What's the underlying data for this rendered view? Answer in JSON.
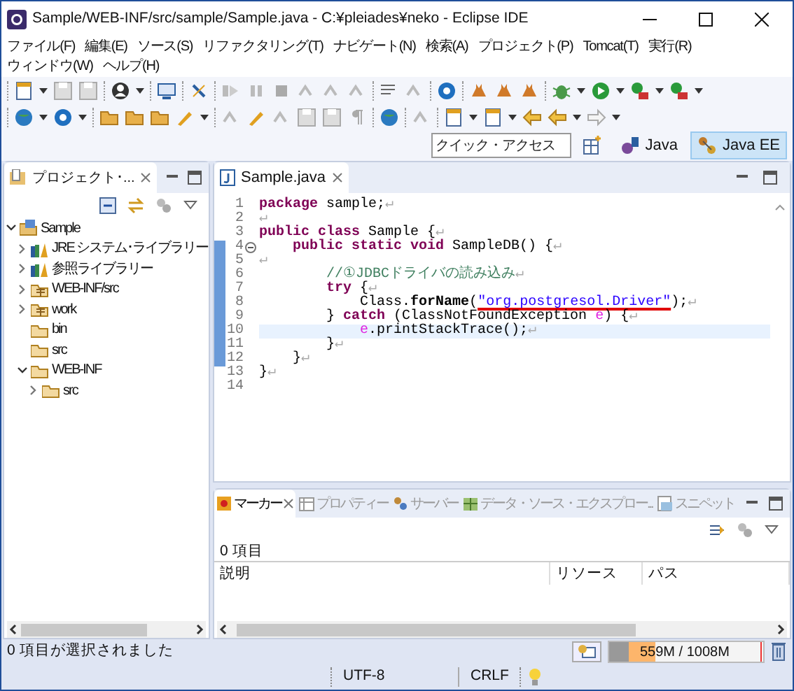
{
  "window": {
    "title": "Sample/WEB-INF/src/sample/Sample.java - C:¥pleiades¥neko - Eclipse IDE"
  },
  "menu": [
    "ファイル(F)",
    "編集(E)",
    "ソース(S)",
    "リファクタリング(T)",
    "ナビゲート(N)",
    "検索(A)",
    "プロジェクト(P)",
    "Tomcat(T)",
    "実行(R)",
    "ウィンドウ(W)",
    "ヘルプ(H)"
  ],
  "quick_access": {
    "placeholder": "クイック・アクセス"
  },
  "perspectives": [
    {
      "label": "Java",
      "selected": false
    },
    {
      "label": "Java EE",
      "selected": true
    }
  ],
  "explorer": {
    "tab": "プロジェクト･...",
    "tree": [
      {
        "label": "Sample",
        "kind": "project",
        "expanded": true,
        "children": [
          {
            "label": "JRE システム･ライブラリー",
            "kind": "library",
            "expanded": false
          },
          {
            "label": "参照ライブラリー",
            "kind": "library",
            "expanded": false
          },
          {
            "label": "WEB-INF/src",
            "kind": "package-folder",
            "expanded": false
          },
          {
            "label": "work",
            "kind": "package-folder",
            "expanded": false
          },
          {
            "label": "bin",
            "kind": "folder"
          },
          {
            "label": "src",
            "kind": "folder"
          },
          {
            "label": "WEB-INF",
            "kind": "folder",
            "expanded": true,
            "children": [
              {
                "label": "src",
                "kind": "folder",
                "expanded": false
              }
            ]
          }
        ]
      }
    ]
  },
  "editor": {
    "tab": "Sample.java",
    "lines": [
      {
        "number": "1",
        "current": false,
        "changed": false,
        "segments": [
          {
            "kind": "keyword",
            "text": "package"
          },
          {
            "kind": "plain",
            "text": " sample;"
          },
          {
            "kind": "mark",
            "text": "↵"
          }
        ]
      },
      {
        "number": "2",
        "current": false,
        "changed": false,
        "segments": [
          {
            "kind": "mark",
            "text": "↵"
          }
        ]
      },
      {
        "number": "3",
        "current": false,
        "changed": false,
        "segments": [
          {
            "kind": "keyword",
            "text": "public class"
          },
          {
            "kind": "plain",
            "text": " Sample {"
          },
          {
            "kind": "mark",
            "text": "↵"
          }
        ]
      },
      {
        "number": "4",
        "current": false,
        "changed": true,
        "fold": true,
        "segments": [
          {
            "kind": "keyword",
            "text": "    public static void"
          },
          {
            "kind": "plain",
            "text": " SampleDB() {"
          },
          {
            "kind": "mark",
            "text": "↵"
          }
        ]
      },
      {
        "number": "5",
        "current": false,
        "changed": true,
        "segments": [
          {
            "kind": "mark",
            "text": "↵"
          }
        ]
      },
      {
        "number": "6",
        "current": false,
        "changed": true,
        "segments": [
          {
            "kind": "comment",
            "text": "        //①JDBCドライバの読み込み"
          },
          {
            "kind": "mark",
            "text": "↵"
          }
        ]
      },
      {
        "number": "7",
        "current": false,
        "changed": true,
        "segments": [
          {
            "kind": "keyword",
            "text": "        try"
          },
          {
            "kind": "plain",
            "text": " {"
          },
          {
            "kind": "mark",
            "text": "↵"
          }
        ]
      },
      {
        "number": "8",
        "current": false,
        "changed": true,
        "segments": [
          {
            "kind": "plain",
            "text": "            Class."
          },
          {
            "kind": "method",
            "text": "forName"
          },
          {
            "kind": "plain",
            "text": "("
          },
          {
            "kind": "string",
            "text": "\"org.postgresol.Driver\"",
            "underlined": true
          },
          {
            "kind": "plain",
            "text": ");"
          },
          {
            "kind": "mark",
            "text": "↵"
          }
        ]
      },
      {
        "number": "9",
        "current": false,
        "changed": true,
        "segments": [
          {
            "kind": "plain",
            "text": "        } "
          },
          {
            "kind": "keyword",
            "text": "catch"
          },
          {
            "kind": "plain",
            "text": " (ClassNotFoundException "
          },
          {
            "kind": "variable",
            "text": "e"
          },
          {
            "kind": "plain",
            "text": ") {"
          },
          {
            "kind": "mark",
            "text": "↵"
          }
        ]
      },
      {
        "number": "10",
        "current": true,
        "changed": true,
        "segments": [
          {
            "kind": "variable",
            "text": "            e"
          },
          {
            "kind": "plain",
            "text": ".printStackTrace();"
          },
          {
            "kind": "mark",
            "text": "↵"
          }
        ]
      },
      {
        "number": "11",
        "current": false,
        "changed": true,
        "segments": [
          {
            "kind": "plain",
            "text": "        }"
          },
          {
            "kind": "mark",
            "text": "↵"
          }
        ]
      },
      {
        "number": "12",
        "current": false,
        "changed": true,
        "segments": [
          {
            "kind": "plain",
            "text": "    }"
          },
          {
            "kind": "mark",
            "text": "↵"
          }
        ]
      },
      {
        "number": "13",
        "current": false,
        "changed": false,
        "segments": [
          {
            "kind": "plain",
            "text": "}"
          },
          {
            "kind": "mark",
            "text": "↵"
          }
        ]
      },
      {
        "number": "14",
        "current": false,
        "changed": false
      }
    ]
  },
  "bottom_panel": {
    "tabs": [
      {
        "label": "マーカー",
        "selected": true
      },
      {
        "label": "プロパティー",
        "selected": false
      },
      {
        "label": "サーバー",
        "selected": false
      },
      {
        "label": "データ・ソース・エクスプロー...",
        "selected": false
      },
      {
        "label": "スニペット",
        "selected": false
      }
    ],
    "count": "0 項目",
    "columns": [
      "説明",
      "リソース",
      "パス"
    ]
  },
  "status_bar": {
    "message": "0 項目が選択されました",
    "heap": {
      "text": "559M / 1008M",
      "level": 0.3
    },
    "encoding": "UTF-8",
    "line_delimiter": "CRLF"
  }
}
